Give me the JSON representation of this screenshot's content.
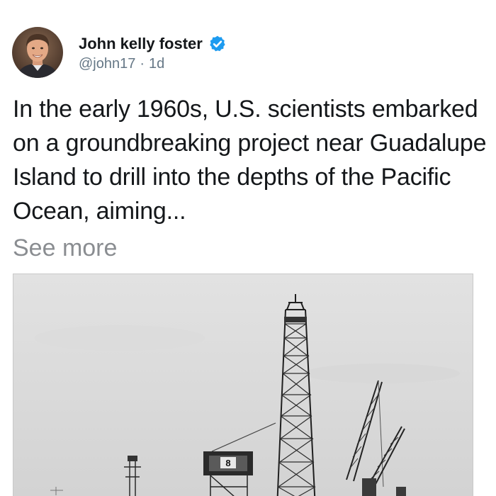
{
  "author": {
    "display_name": "John kelly foster",
    "handle": "@john17",
    "separator": "·",
    "time": "1d",
    "verified": true,
    "verified_color": "#1d9bf0"
  },
  "post": {
    "text": "In the early 1960s, U.S. scientists embarked on a groundbreaking project near Guadalupe Island to drill into the depths of the Pacific Ocean, aiming...",
    "see_more_label": "See more"
  },
  "media": {
    "kind": "black-and-white photograph",
    "visible_marking": "8"
  },
  "colors": {
    "text_primary": "#14171a",
    "text_secondary": "#657786",
    "see_more": "#8a8d91"
  }
}
